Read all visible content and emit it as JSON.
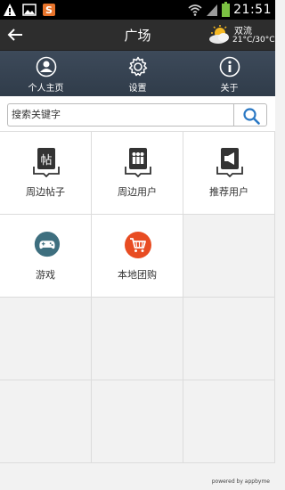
{
  "status_bar": {
    "time": "21:51",
    "icons": [
      "warning-icon",
      "gallery-icon",
      "app-s-icon",
      "wifi-icon",
      "signal-icon",
      "battery-icon"
    ]
  },
  "header": {
    "title": "广场",
    "weather": {
      "city": "双流",
      "temp": "21°C/30°C",
      "icon": "partly-cloudy-icon"
    }
  },
  "nav": [
    {
      "label": "个人主页",
      "icon": "user-icon"
    },
    {
      "label": "设置",
      "icon": "gear-icon"
    },
    {
      "label": "关于",
      "icon": "info-icon"
    }
  ],
  "search": {
    "placeholder": "搜索关键字"
  },
  "grid": [
    {
      "label": "周边帖子",
      "icon": "posts-icon",
      "glyph": "帖"
    },
    {
      "label": "周边用户",
      "icon": "nearby-users-icon"
    },
    {
      "label": "推荐用户",
      "icon": "recommend-users-icon"
    },
    {
      "label": "游戏",
      "icon": "gamepad-icon"
    },
    {
      "label": "本地团购",
      "icon": "shopping-cart-icon"
    }
  ],
  "footer": "powered by appbyme",
  "colors": {
    "header": "#2d2d2d",
    "nav": "#36424f",
    "game_icon": "#3e6f7f",
    "cart_icon": "#e84c22"
  }
}
